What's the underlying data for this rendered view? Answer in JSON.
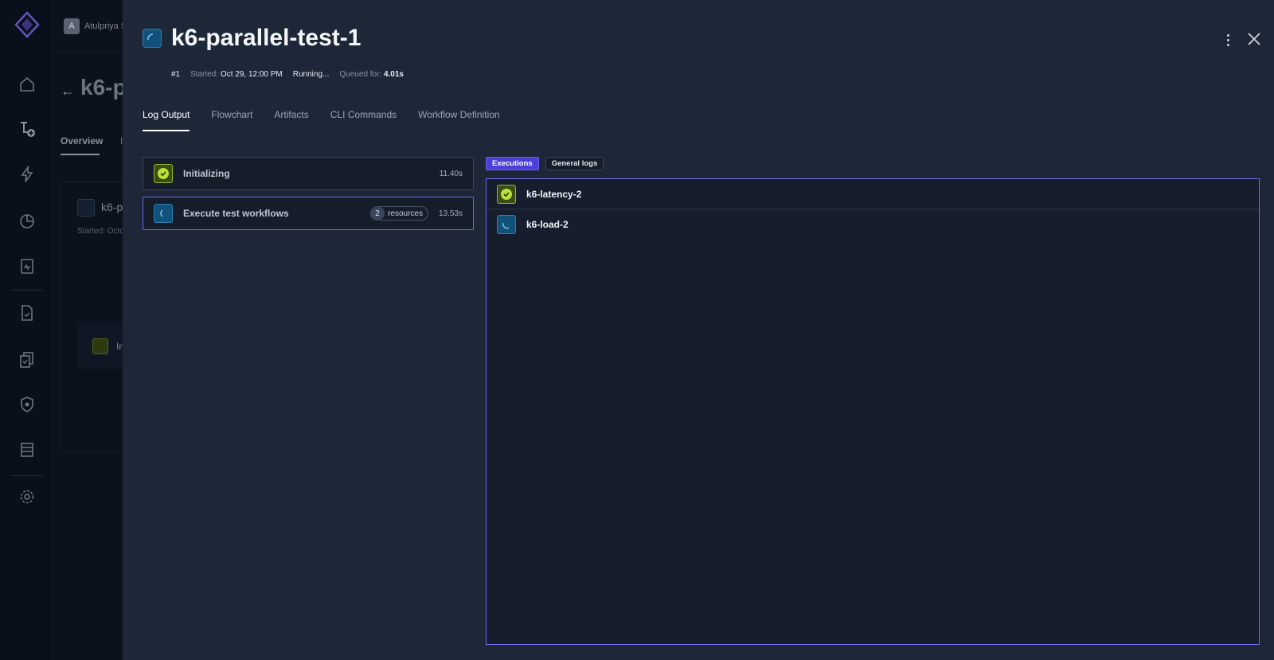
{
  "background": {
    "user_initial": "A",
    "user_name": "Atulpriya S",
    "page_title": "k6-p",
    "tab_overview": "Overview",
    "tab_second": "I",
    "card_title": "k6-p",
    "card_subtitle": "Started: Octo",
    "step_label": "In"
  },
  "drawer": {
    "title": "k6-parallel-test-1",
    "meta": {
      "run_number": "#1",
      "started_label": "Started:",
      "started_value": "Oct 29, 12:00 PM",
      "status": "Running...",
      "queued_label": "Queued for:",
      "queued_value": "4.01s"
    },
    "tabs": [
      {
        "label": "Log Output",
        "active": true
      },
      {
        "label": "Flowchart",
        "active": false
      },
      {
        "label": "Artifacts",
        "active": false
      },
      {
        "label": "CLI Commands",
        "active": false
      },
      {
        "label": "Workflow Definition",
        "active": false
      }
    ],
    "steps": [
      {
        "name": "Initializing",
        "status": "success-icon",
        "time": "11.40s"
      },
      {
        "name": "Execute test workflows",
        "status": "running-icon",
        "resource_count": "2",
        "resource_label": "resources",
        "time": "13.53s"
      }
    ],
    "log_toggles": {
      "executions": "Executions",
      "general_logs": "General logs"
    },
    "executions": [
      {
        "name": "k6-latency-2",
        "status": "success-icon"
      },
      {
        "name": "k6-load-2",
        "status": "running-icon"
      }
    ]
  },
  "colors": {
    "accent": "#6c6cf0",
    "success": "#b8e23a",
    "running": "#12527a",
    "drawer_bg": "#1d2737"
  }
}
